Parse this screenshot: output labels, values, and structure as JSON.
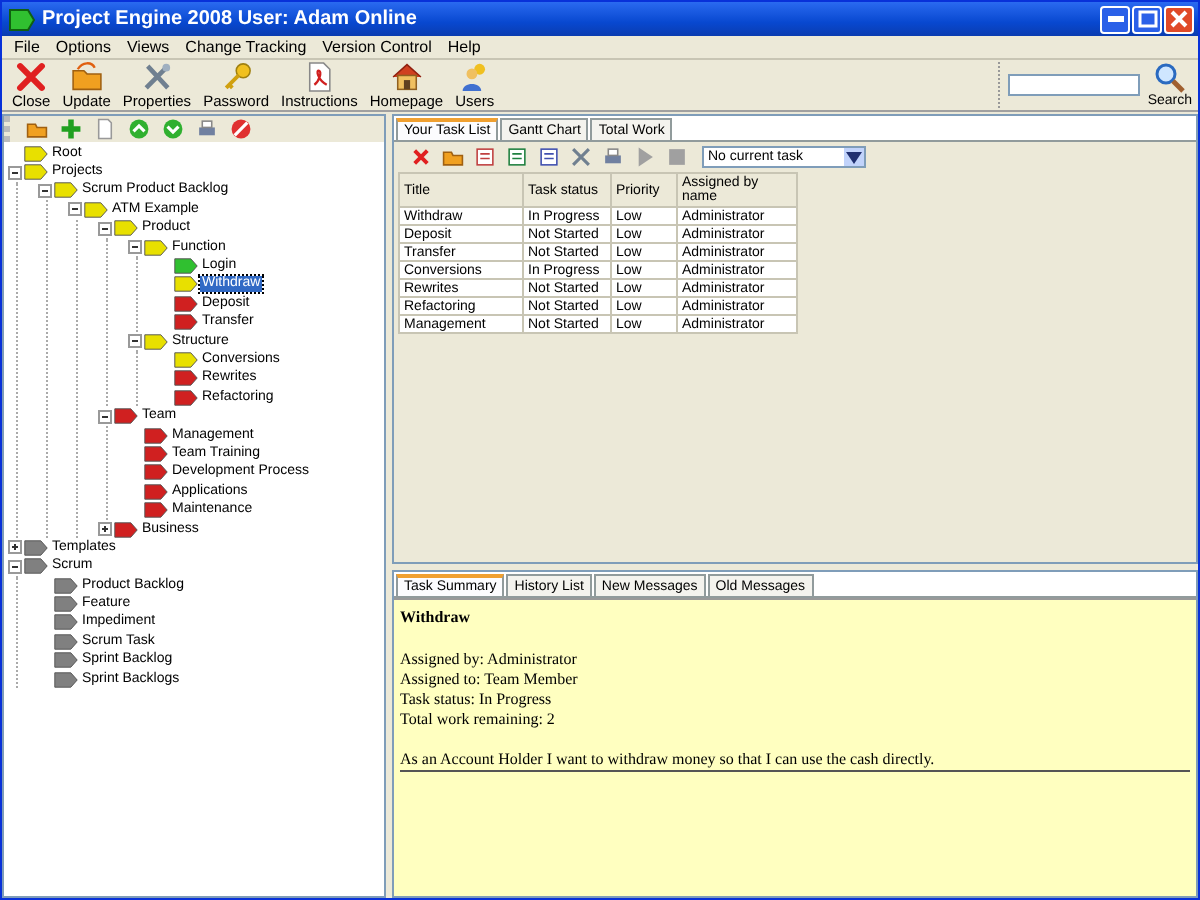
{
  "window": {
    "title": "Project Engine 2008  User: Adam  Online"
  },
  "menu": [
    "File",
    "Options",
    "Views",
    "Change Tracking",
    "Version Control",
    "Help"
  ],
  "toolbar": [
    {
      "label": "Close",
      "kind": "close"
    },
    {
      "label": "Update",
      "kind": "update"
    },
    {
      "label": "Properties",
      "kind": "properties"
    },
    {
      "label": "Password",
      "kind": "password"
    },
    {
      "label": "Instructions",
      "kind": "instructions"
    },
    {
      "label": "Homepage",
      "kind": "homepage"
    },
    {
      "label": "Users",
      "kind": "users"
    }
  ],
  "search": {
    "label": "Search"
  },
  "tree": [
    {
      "label": "Root",
      "color": "#e8e000",
      "selected": false
    },
    {
      "label": "Projects",
      "color": "#e8e000",
      "selected": false,
      "expanded": true,
      "children": [
        {
          "label": "Scrum Product Backlog",
          "color": "#e8e000",
          "selected": false,
          "expanded": true,
          "children": [
            {
              "label": "ATM Example",
              "color": "#e8e000",
              "selected": false,
              "expanded": true,
              "children": [
                {
                  "label": "Product",
                  "color": "#e8e000",
                  "selected": false,
                  "expanded": true,
                  "children": [
                    {
                      "label": "Function",
                      "color": "#e8e000",
                      "selected": false,
                      "expanded": true,
                      "children": [
                        {
                          "label": "Login",
                          "color": "#30c030",
                          "selected": false
                        },
                        {
                          "label": "Withdraw",
                          "color": "#e8e000",
                          "selected": true
                        },
                        {
                          "label": "Deposit",
                          "color": "#d02020",
                          "selected": false
                        },
                        {
                          "label": "Transfer",
                          "color": "#d02020",
                          "selected": false
                        }
                      ]
                    },
                    {
                      "label": "Structure",
                      "color": "#e8e000",
                      "selected": false,
                      "expanded": true,
                      "children": [
                        {
                          "label": "Conversions",
                          "color": "#e8e000",
                          "selected": false
                        },
                        {
                          "label": "Rewrites",
                          "color": "#d02020",
                          "selected": false
                        },
                        {
                          "label": "Refactoring",
                          "color": "#d02020",
                          "selected": false
                        }
                      ]
                    }
                  ]
                },
                {
                  "label": "Team",
                  "color": "#d02020",
                  "selected": false,
                  "expanded": true,
                  "children": [
                    {
                      "label": "Management",
                      "color": "#d02020",
                      "selected": false
                    },
                    {
                      "label": "Team Training",
                      "color": "#d02020",
                      "selected": false
                    },
                    {
                      "label": "Development Process",
                      "color": "#d02020",
                      "selected": false
                    },
                    {
                      "label": "Applications",
                      "color": "#d02020",
                      "selected": false
                    },
                    {
                      "label": "Maintenance",
                      "color": "#d02020",
                      "selected": false
                    }
                  ]
                },
                {
                  "label": "Business",
                  "color": "#d02020",
                  "selected": false,
                  "expanded": false
                }
              ]
            }
          ]
        }
      ]
    },
    {
      "label": "Templates",
      "color": "#808080",
      "selected": false,
      "expanded": false
    },
    {
      "label": "Scrum",
      "color": "#808080",
      "selected": false,
      "expanded": true,
      "children": [
        {
          "label": "Product Backlog",
          "color": "#808080",
          "selected": false
        },
        {
          "label": "Feature",
          "color": "#808080",
          "selected": false
        },
        {
          "label": "Impediment",
          "color": "#808080",
          "selected": false
        },
        {
          "label": "Scrum Task",
          "color": "#808080",
          "selected": false
        },
        {
          "label": "Sprint Backlog",
          "color": "#808080",
          "selected": false
        },
        {
          "label": "Sprint Backlogs",
          "color": "#808080",
          "selected": false
        }
      ]
    }
  ],
  "task_tabs": [
    {
      "label": "Your Task List",
      "selected": true
    },
    {
      "label": "Gantt Chart",
      "selected": false
    },
    {
      "label": "Total Work",
      "selected": false
    }
  ],
  "current_task": {
    "value": "No current task"
  },
  "table": {
    "columns": [
      "Title",
      "Task status",
      "Priority",
      "Assigned by name"
    ],
    "rows": [
      [
        "Withdraw",
        "In Progress",
        "Low",
        "Administrator"
      ],
      [
        "Deposit",
        "Not Started",
        "Low",
        "Administrator"
      ],
      [
        "Transfer",
        "Not Started",
        "Low",
        "Administrator"
      ],
      [
        "Conversions",
        "In Progress",
        "Low",
        "Administrator"
      ],
      [
        "Rewrites",
        "Not Started",
        "Low",
        "Administrator"
      ],
      [
        "Refactoring",
        "Not Started",
        "Low",
        "Administrator"
      ],
      [
        "Management",
        "Not Started",
        "Low",
        "Administrator"
      ]
    ]
  },
  "summary_tabs": [
    {
      "label": "Task Summary",
      "selected": true
    },
    {
      "label": "History List",
      "selected": false
    },
    {
      "label": "New Messages",
      "selected": false
    },
    {
      "label": "Old Messages",
      "selected": false
    }
  ],
  "summary": {
    "title": "Withdraw",
    "lines": [
      "Assigned by: Administrator",
      "Assigned to: Team Member",
      "Task status: In Progress",
      "Total work remaining: 2"
    ],
    "description": "As an Account Holder I want to withdraw money so that I can use the cash directly."
  }
}
